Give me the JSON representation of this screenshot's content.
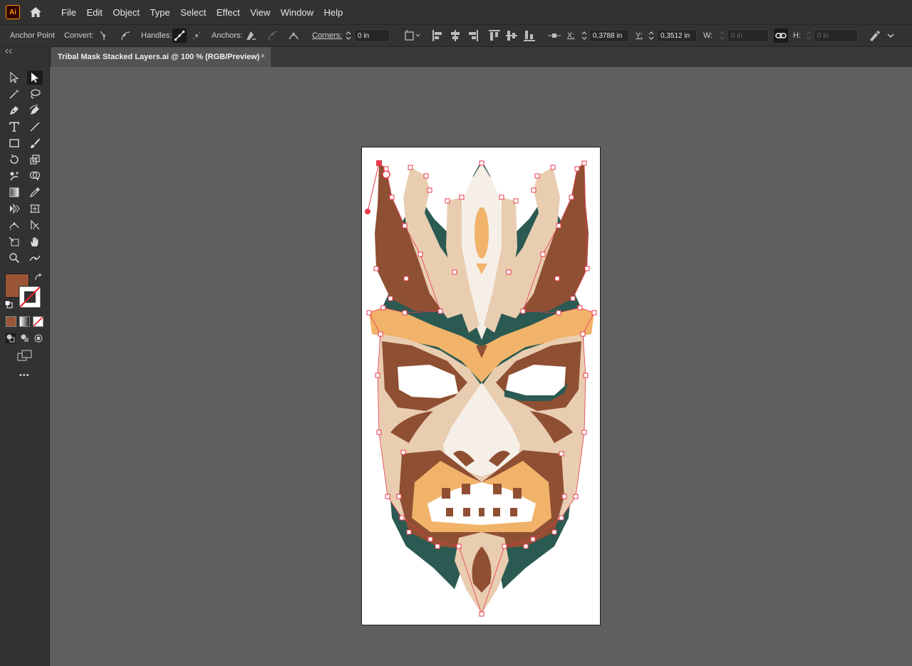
{
  "app": {
    "logo_text": "Ai"
  },
  "menu": [
    "File",
    "Edit",
    "Object",
    "Type",
    "Select",
    "Effect",
    "View",
    "Window",
    "Help"
  ],
  "control": {
    "tool_name": "Anchor Point",
    "convert_label": "Convert:",
    "handles_label": "Handles:",
    "anchors_label": "Anchors:",
    "corners_label": "Corners:",
    "corners_value": "0 in",
    "x_label": "X:",
    "x_value": "0,3788 in",
    "y_label": "Y:",
    "y_value": "0,3512 in",
    "w_label": "W:",
    "w_value": "0 in",
    "h_label": "H:",
    "h_value": "0 in"
  },
  "document": {
    "tab_title": "Tribal Mask Stacked Layers.ai @ 100 % (RGB/Preview)",
    "close_glyph": "×"
  },
  "toolbar": {
    "fill_color": "#9a5535",
    "more_glyph": "•••",
    "tools": [
      "selection-tool",
      "direct-selection-tool",
      "magic-wand-tool",
      "lasso-tool",
      "pen-tool",
      "curvature-tool",
      "type-tool",
      "line-segment-tool",
      "rectangle-tool",
      "paintbrush-tool",
      "rotate-tool",
      "scale-tool",
      "puppet-warp-tool",
      "shape-builder-tool",
      "gradient-tool",
      "eyedropper-tool",
      "blend-tool",
      "artboard-tool",
      "width-tool",
      "free-transform-tool",
      "slice-tool",
      "hand-tool",
      "zoom-tool",
      "curvature-path-tool"
    ]
  },
  "colors": {
    "dark_brown": "#8f4f33",
    "tan": "#e9cdb0",
    "orange": "#f1b36a",
    "cream": "#f5efe8",
    "teal": "#2b5a52",
    "selection": "#e8394f"
  }
}
